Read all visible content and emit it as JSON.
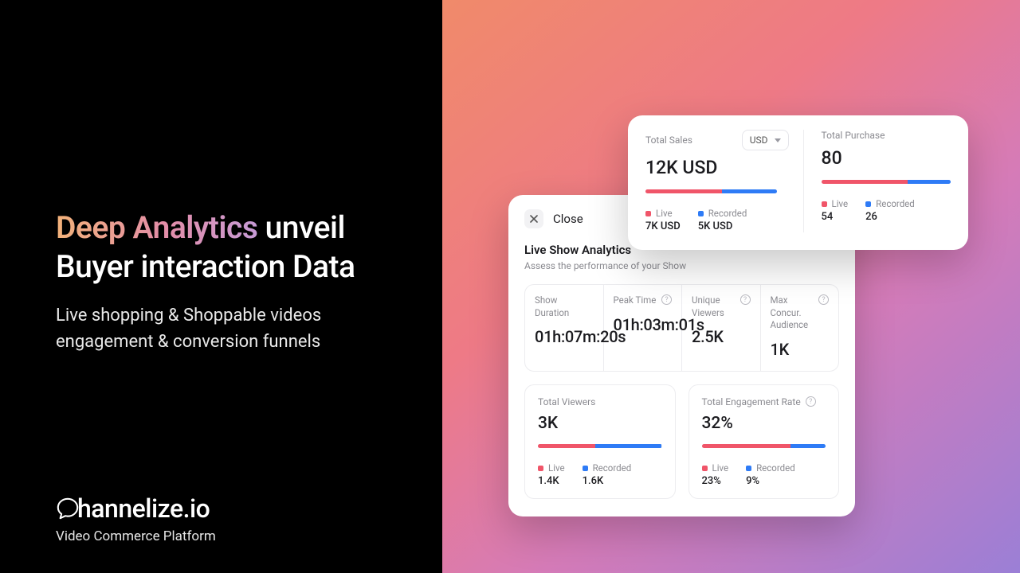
{
  "headline": {
    "em": "Deep Analytics",
    "rest": " unveil Buyer interaction Data"
  },
  "subhead": "Live shopping & Shoppable videos engagement & conversion funnels",
  "brand": {
    "name": "hannelize.io",
    "tag": "Video Commerce Platform"
  },
  "close": "Close",
  "main": {
    "title": "Live Show Analytics",
    "sub": "Assess the performance of your Show",
    "metrics": [
      {
        "t": "Show Duration",
        "v": "01h:07m:20s",
        "info": false
      },
      {
        "t": "Peak Time",
        "v": "01h:03m:01s",
        "info": true
      },
      {
        "t": "Unique Viewers",
        "v": "2.5K",
        "info": true
      },
      {
        "t": "Max Concur. Audience",
        "v": "1K",
        "info": true
      }
    ],
    "panels": [
      {
        "t": "Total Viewers",
        "v": "3K",
        "live_lbl": "Live",
        "rec_lbl": "Recorded",
        "live": "1.4K",
        "rec": "1.6K",
        "live_pct": 46,
        "rec_pct": 54,
        "info": false
      },
      {
        "t": "Total Engagement Rate",
        "v": "32%",
        "live_lbl": "Live",
        "rec_lbl": "Recorded",
        "live": "23%",
        "rec": "9%",
        "live_pct": 72,
        "rec_pct": 28,
        "info": true
      }
    ]
  },
  "top": {
    "sales": {
      "t": "Total Sales",
      "currency": "USD",
      "v": "12K USD",
      "live_lbl": "Live",
      "rec_lbl": "Recorded",
      "live": "7K USD",
      "rec": "5K USD",
      "live_pct": 58,
      "rec_pct": 42
    },
    "purchase": {
      "t": "Total Purchase",
      "v": "80",
      "live_lbl": "Live",
      "rec_lbl": "Recorded",
      "live": "54",
      "rec": "26",
      "live_pct": 67,
      "rec_pct": 33
    }
  }
}
